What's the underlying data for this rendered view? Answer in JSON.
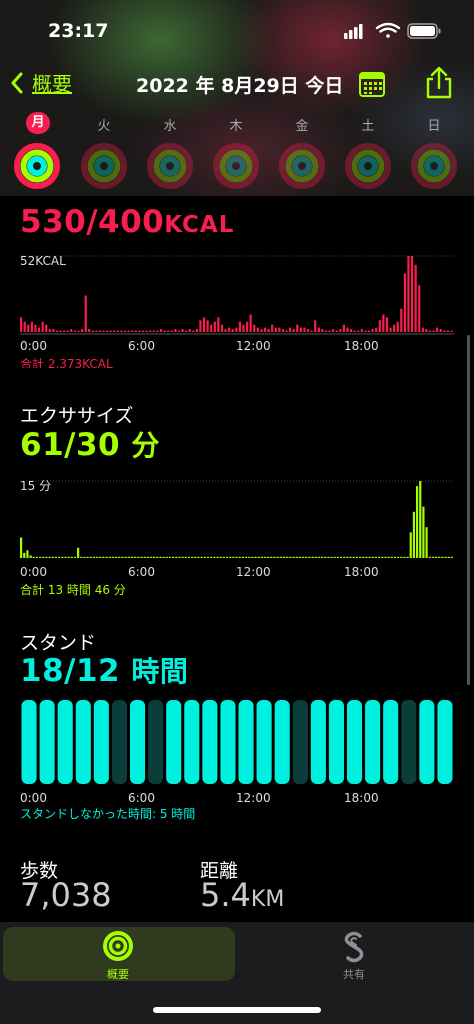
{
  "status": {
    "time": "23:17"
  },
  "nav": {
    "back_label": "概要",
    "title": "2022 年 8月29日 今日"
  },
  "week": {
    "days": [
      "月",
      "火",
      "水",
      "木",
      "金",
      "土",
      "日"
    ],
    "selected_index": 0
  },
  "move": {
    "value": "530/400",
    "unit": "KCAL",
    "chart_max_label": "52KCAL",
    "total": "合計 2,373KCAL",
    "color": "#fa1e4e"
  },
  "exercise": {
    "title": "エクササイズ",
    "value": "61/30",
    "unit": "分",
    "chart_max_label": "15 分",
    "total": "合計 13 時間 46 分",
    "color": "#a6ff00"
  },
  "stand": {
    "title": "スタンド",
    "value": "18/12",
    "unit": "時間",
    "footnote": "スタンドしなかった時間: 5 時間",
    "color": "#00f0e0"
  },
  "time_axis": [
    "0:00",
    "6:00",
    "12:00",
    "18:00"
  ],
  "steps": {
    "label": "歩数",
    "value": "7,038"
  },
  "distance": {
    "label": "距離",
    "value": "5.4",
    "unit": "KM"
  },
  "tabs": [
    {
      "label": "概要",
      "active": true
    },
    {
      "label": "共有",
      "active": false
    }
  ],
  "chart_data": [
    {
      "type": "bar",
      "title": "530/400KCAL",
      "ylabel": "52KCAL",
      "ylim": [
        0,
        52
      ],
      "x_tick_labels": [
        "0:00",
        "6:00",
        "12:00",
        "18:00"
      ],
      "series": [
        {
          "values": [
            10,
            7,
            5,
            7,
            5,
            3,
            7,
            5,
            2,
            2,
            1,
            1,
            1,
            1,
            2,
            1,
            1,
            2,
            25,
            2,
            1,
            1,
            1,
            1,
            1,
            1,
            1,
            1,
            1,
            1,
            1,
            1,
            1,
            1,
            1,
            1,
            1,
            1,
            1,
            2,
            1,
            1,
            1,
            2,
            1,
            2,
            1,
            2,
            1,
            2,
            8,
            10,
            8,
            5,
            7,
            10,
            5,
            2,
            3,
            2,
            3,
            7,
            5,
            7,
            12,
            5,
            3,
            2,
            3,
            2,
            5,
            3,
            3,
            2,
            1,
            3,
            2,
            5,
            3,
            3,
            2,
            1,
            8,
            3,
            2,
            1,
            1,
            2,
            1,
            2,
            5,
            3,
            2,
            1,
            1,
            2,
            1,
            1,
            2,
            3,
            8,
            12,
            10,
            3,
            5,
            7,
            16,
            40,
            52,
            52,
            46,
            32,
            3,
            2,
            1,
            1,
            3,
            2,
            1,
            1,
            1
          ]
        }
      ]
    },
    {
      "type": "bar",
      "title": "61/30 分",
      "ylabel": "15 分",
      "ylim": [
        0,
        15
      ],
      "x_tick_labels": [
        "0:00",
        "6:00",
        "12:00",
        "18:00"
      ],
      "series": [
        {
          "values": [
            4,
            1,
            1.5,
            0.5,
            0,
            0,
            0,
            0,
            0,
            0,
            0,
            0,
            0,
            0,
            0,
            0,
            0,
            0,
            2,
            0,
            0,
            0,
            0,
            0,
            0,
            0,
            0,
            0,
            0,
            0,
            0,
            0,
            0,
            0,
            0,
            0,
            0,
            0,
            0,
            0,
            0,
            0,
            0,
            0,
            0,
            0,
            0,
            0,
            0,
            0,
            0,
            0,
            0,
            0,
            0,
            0,
            0,
            0,
            0,
            0,
            0,
            0,
            0,
            0,
            0,
            0,
            0,
            0,
            0,
            0,
            0,
            0,
            0,
            0,
            0,
            0,
            0,
            0,
            0,
            0,
            0,
            0,
            0,
            0,
            0,
            0,
            0,
            0,
            0,
            0,
            0,
            0,
            0,
            0,
            0,
            0,
            0,
            0,
            0,
            0,
            0,
            0,
            0,
            0,
            0,
            0,
            0,
            0,
            0,
            0,
            0,
            0,
            0,
            0,
            0,
            0,
            0,
            0,
            0,
            0,
            0,
            0,
            0,
            5,
            9,
            14,
            15,
            10,
            6,
            0,
            0,
            0,
            0,
            0,
            0,
            0,
            0
          ]
        }
      ]
    },
    {
      "type": "bar",
      "title": "18/12 時間",
      "x_tick_labels": [
        "0:00",
        "6:00",
        "12:00",
        "18:00"
      ],
      "series": [
        {
          "name": "stood",
          "values": [
            1,
            1,
            1,
            1,
            1,
            0,
            1,
            0,
            1,
            1,
            1,
            1,
            1,
            1,
            1,
            0,
            1,
            1,
            1,
            1,
            1,
            0,
            1,
            1
          ]
        }
      ]
    }
  ]
}
